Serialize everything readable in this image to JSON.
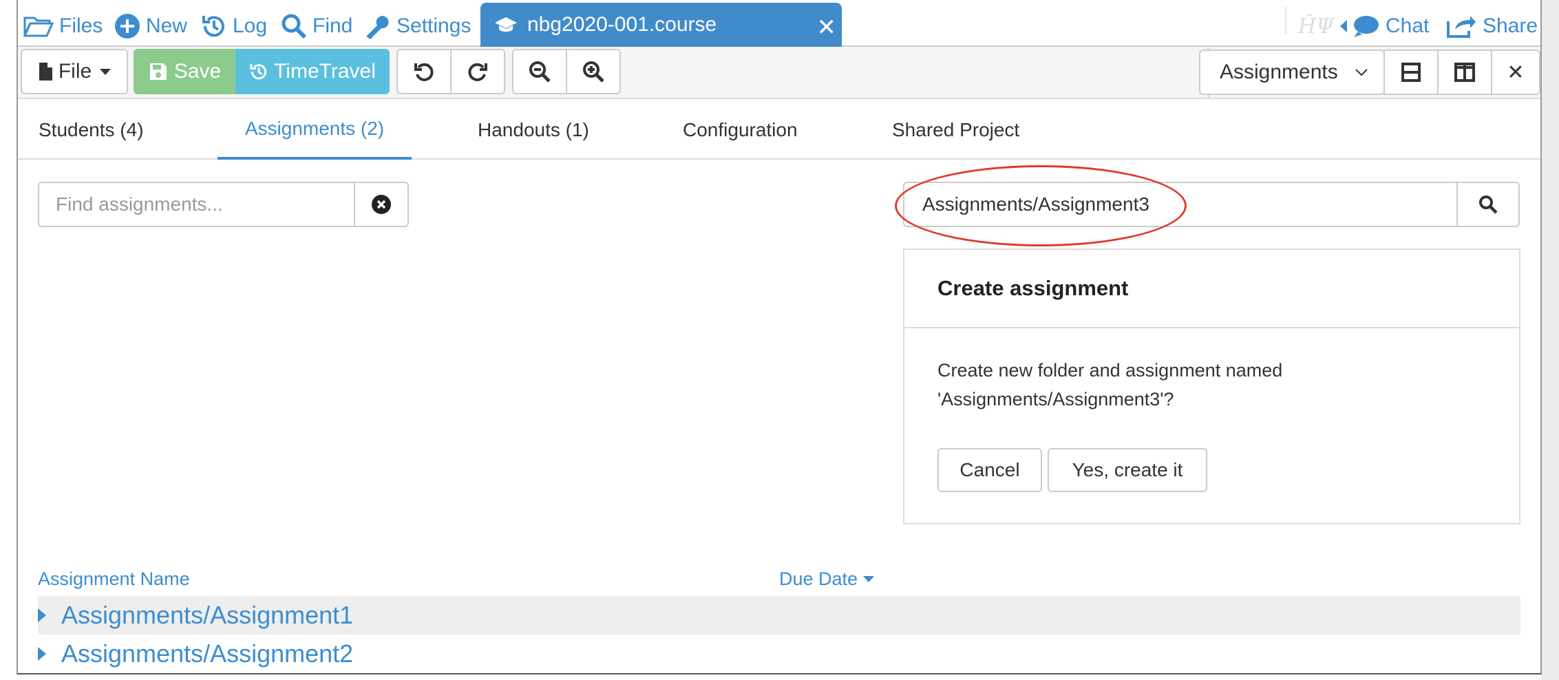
{
  "topnav": {
    "files": "Files",
    "new": "New",
    "log": "Log",
    "find": "Find",
    "settings": "Settings",
    "active_tab": "nbg2020-001.course",
    "chat": "Chat",
    "share": "Share"
  },
  "toolbar": {
    "file": "File",
    "save": "Save",
    "timetravel": "TimeTravel",
    "frame_select": "Assignments"
  },
  "tabs": [
    {
      "label": "Students (4)"
    },
    {
      "label": "Assignments (2)"
    },
    {
      "label": "Handouts (1)"
    },
    {
      "label": "Configuration"
    },
    {
      "label": "Shared Project"
    }
  ],
  "search": {
    "placeholder": "Find assignments...",
    "new_value": "Assignments/Assignment3"
  },
  "create_panel": {
    "title": "Create assignment",
    "line1": "Create new folder and assignment named",
    "line2": "'Assignments/Assignment3'?",
    "cancel": "Cancel",
    "confirm": "Yes, create it"
  },
  "list": {
    "col_name": "Assignment Name",
    "col_due": "Due Date",
    "rows": [
      {
        "name": "Assignments/Assignment1"
      },
      {
        "name": "Assignments/Assignment2"
      }
    ]
  },
  "colors": {
    "accent": "#428bca",
    "link": "#3c8dd0",
    "save": "#8ccb8c",
    "timetravel": "#5bc0de",
    "highlight": "#e03a2c"
  }
}
